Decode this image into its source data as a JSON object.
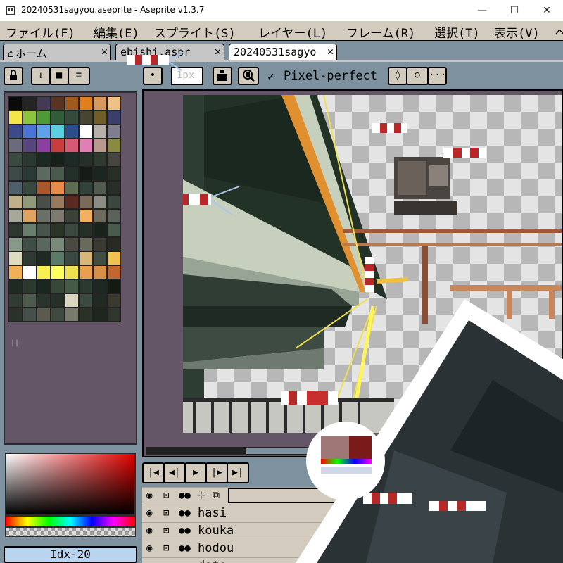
{
  "window": {
    "title": "20240531sagyou.aseprite - Aseprite v1.3.7",
    "minimize_glyph": "—",
    "maximize_glyph": "☐",
    "close_glyph": "✕"
  },
  "menu": [
    "ファイル(F)",
    "編集(E)",
    "スプライト(S)",
    "レイヤー(L)",
    "フレーム(R)",
    "選択(T)",
    "表示(V)",
    "ヘ"
  ],
  "tabs": [
    {
      "label": "ホーム",
      "close": "✕",
      "icon": "home-icon"
    },
    {
      "label": "ebishi.aspr",
      "close": "✕"
    },
    {
      "label": "20240531sagyo",
      "close": "✕",
      "active": true
    }
  ],
  "toolbar": {
    "brush_size_placeholder": "1px",
    "pixel_perfect_check": "✓",
    "pixel_perfect_label": "Pixel-perfect",
    "more_glyph": "···"
  },
  "palette": {
    "colors": [
      "#0a0a0a",
      "#242424",
      "#453a55",
      "#5a3322",
      "#a05a1e",
      "#e07f1e",
      "#d69a5e",
      "#f0c186",
      "#f4e54a",
      "#8cc43e",
      "#4f9a36",
      "#2f5d3a",
      "#354a3a",
      "#454532",
      "#6f5e2a",
      "#3c3e6a",
      "#3a4a8a",
      "#4a74d6",
      "#5fa0e8",
      "#5ad0e2",
      "#2a4e8a",
      "#ffffff",
      "#b8b0a6",
      "#7e7e8e",
      "#6b6b7b",
      "#57467e",
      "#8a3fa0",
      "#c93d3d",
      "#d65a76",
      "#e07fb6",
      "#b89a8e",
      "#8a8a42",
      "#3a4a40",
      "#2a3a32",
      "#1a2a22",
      "#18201a",
      "#1e2a26",
      "#243028",
      "#2e3a30",
      "#46463e",
      "#3e4a48",
      "#2a3a36",
      "#5a6a5e",
      "#4a5a4e",
      "#22302a",
      "#141a16",
      "#1c2620",
      "#263028",
      "#50606a",
      "#384a40",
      "#a8582a",
      "#e88a4a",
      "#5e6a52",
      "#30423a",
      "#525a4e",
      "#2a2e28",
      "#c0b08a",
      "#8e9a7a",
      "#4a4e48",
      "#9a7a5e",
      "#5a2a22",
      "#7a6a5a",
      "#8a8e82",
      "#3a463e",
      "#a8a89a",
      "#e0a460",
      "#6a7068",
      "#7e7a72",
      "#3a4238",
      "#f0b060",
      "#6e6a5e",
      "#5a625a",
      "#2e3830",
      "#6a7e6e",
      "#46544a",
      "#2a3428",
      "#3a4a3e",
      "#263026",
      "#1a221c",
      "#4a5a4e",
      "#8a9a8a",
      "#3e4e44",
      "#58685c",
      "#7a8a7a",
      "#4a4a42",
      "#6a6a5a",
      "#3a3a32",
      "#2a2a24",
      "#dcdcc0",
      "#2e3a34",
      "#1e2a24",
      "#5a7a6a",
      "#3a4a42",
      "#d6b67a",
      "#404e44",
      "#f0c050",
      "#f0b058",
      "#ffffff",
      "#f8f050",
      "#ffff60",
      "#f0e050",
      "#e8a050",
      "#d89048",
      "#c06830",
      "#1e2a22",
      "#2a3a2e",
      "#1a2620",
      "#384838",
      "#465a48",
      "#2a3a2e",
      "#1e2822",
      "#121a14",
      "#303c32",
      "#4e5a4e",
      "#2a342c",
      "#263028",
      "#dcd6c0",
      "#3a4a3e",
      "#202a22",
      "#3a3a30",
      "#2a302a",
      "#46504a",
      "#5a5a4e",
      "#3e4a40",
      "#7a7a6a",
      "#2a3228",
      "#1e2620",
      "#30362e"
    ]
  },
  "index_field": "Idx-20",
  "layers": [
    {
      "name": ""
    },
    {
      "name": "hasi"
    },
    {
      "name": "kouka"
    },
    {
      "name": "hodou"
    },
    {
      "name": "dato"
    }
  ]
}
